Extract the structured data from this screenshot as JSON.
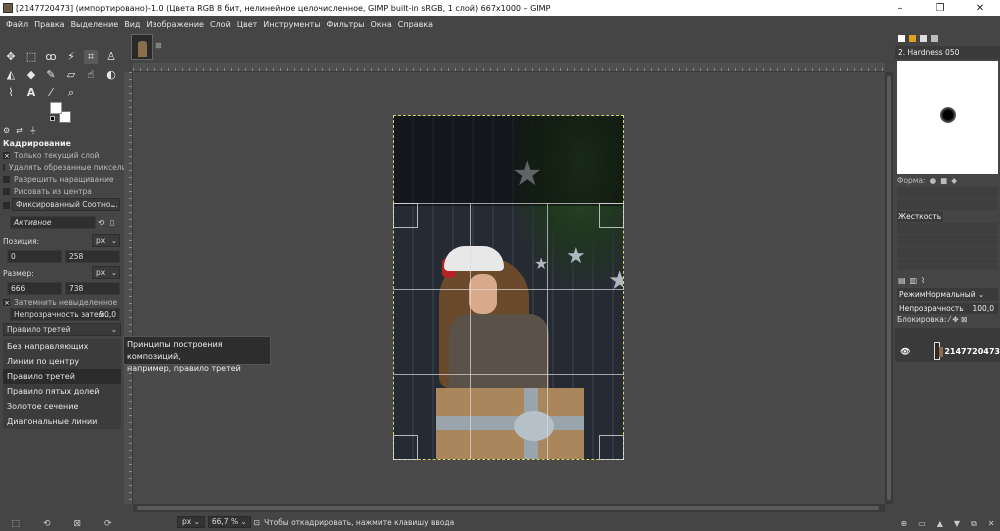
{
  "window": {
    "title": "[2147720473] (импортировано)-1.0 (Цвета RGB 8 бит, нелинейное целочисленное, GIMP built-in sRGB, 1 слой) 667x1000 – GIMP",
    "minimize": "–",
    "maximize": "❐",
    "close": "✕"
  },
  "menu": [
    "Файл",
    "Правка",
    "Выделение",
    "Вид",
    "Изображение",
    "Слой",
    "Цвет",
    "Инструменты",
    "Фильтры",
    "Окна",
    "Справка"
  ],
  "toolbox": {
    "tools": [
      "move-icon",
      "rect-select-icon",
      "lasso-icon",
      "fuzzy-select-icon",
      "crop-icon",
      "clone-stamp-icon",
      "warp-icon",
      "bucket-fill-icon",
      "paintbrush-icon",
      "eraser-icon",
      "smudge-icon",
      "dodge-icon",
      "path-icon",
      "text-icon",
      "color-picker-icon",
      "zoom-icon"
    ]
  },
  "tool_options": {
    "title": "Кадрирование",
    "current_layer_only": "Только текущий слой",
    "delete_cropped": "Удалять обрезанные пиксели",
    "allow_growing": "Разрешить наращивание",
    "draw_from_center": "Рисовать из центра",
    "fixed_label": "Фиксированный Соотно...",
    "fixed_value": "Активное",
    "position_label": "Позиция:",
    "position_unit": "px",
    "position_x": "0",
    "position_y": "258",
    "size_label": "Размер:",
    "size_unit": "px",
    "size_w": "666",
    "size_h": "738",
    "highlight_label": "Затемнить невыделенное",
    "highlight_opacity_label": "Непрозрачность затем...",
    "highlight_opacity_value": "50,0",
    "guides_selected": "Правило третей",
    "guide_options": [
      "Без направляющих",
      "Линии по центру",
      "Правило третей",
      "Правило пятых долей",
      "Золотое сечение",
      "Диагональные линии"
    ],
    "guide_selected_index": 2
  },
  "tooltip": {
    "line1": "Принципы построения композиций,",
    "line2": "например, правило третей"
  },
  "statusbar": {
    "unit": "px",
    "zoom": "66,7 %",
    "message": "Чтобы откадрировать, нажмите клавишу ввода"
  },
  "brushes": {
    "name": "2. Hardness 050",
    "form_label": "Форма:",
    "hardness_label": "Жесткость"
  },
  "layers": {
    "mode_label": "Режим",
    "mode_value": "Нормальный",
    "opacity_label": "Непрозрачность",
    "opacity_value": "100,0",
    "lock_label": "Блокировка:",
    "items": [
      {
        "name": "2147720473"
      }
    ]
  },
  "colors": {
    "accent": "#d8d26a",
    "background": "#454545"
  }
}
